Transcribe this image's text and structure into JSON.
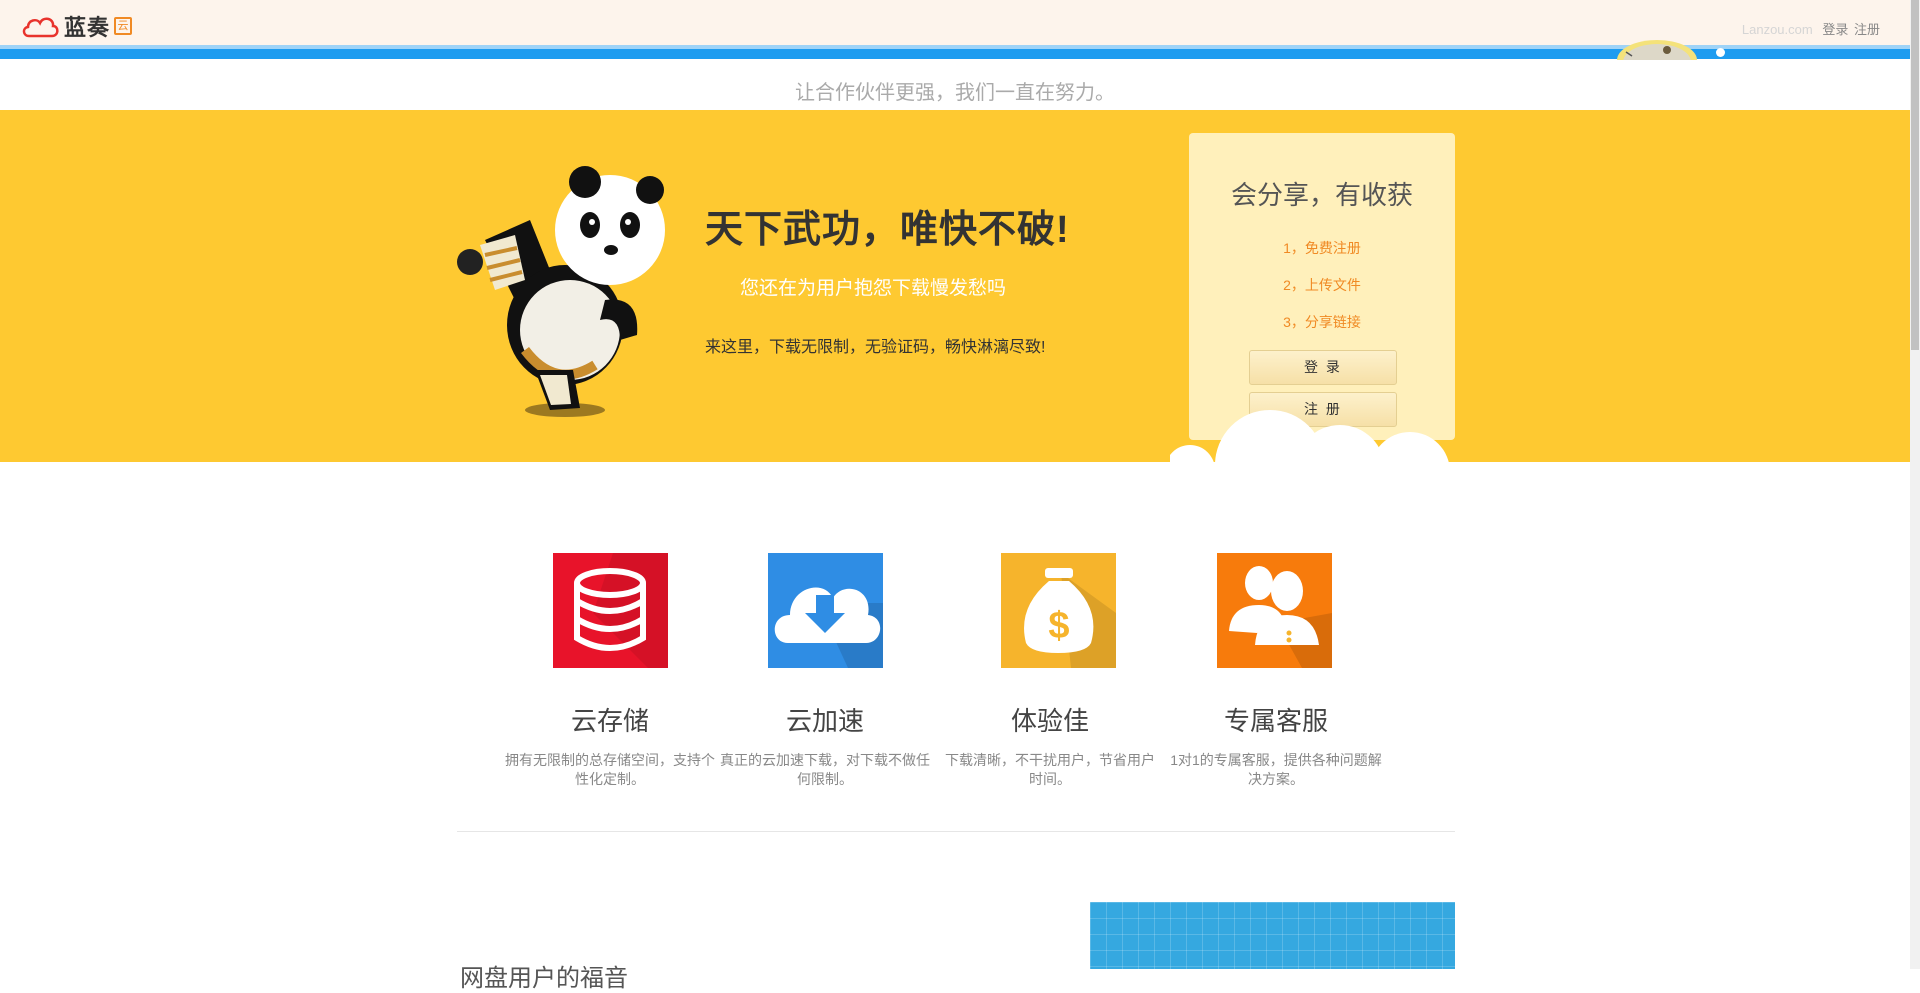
{
  "header": {
    "logo_text": "蓝奏",
    "logo_badge": "云",
    "domain": "Lanzou.com",
    "login": "登录",
    "register": "注册"
  },
  "tagline": "让合作伙伴更强，我们一直在努力。",
  "hero": {
    "title": "天下武功，唯快不破!",
    "subtitle": "您还在为用户抱怨下载慢发愁吗",
    "desc": "来这里，下载无限制，无验证码，畅快淋漓尽致!"
  },
  "card": {
    "title": "会分享，有收获",
    "steps": [
      "1，免费注册",
      "2，上传文件",
      "3，分享链接"
    ],
    "login_button": "登 录",
    "register_button": "注 册"
  },
  "features": [
    {
      "title": "云存储",
      "desc": "拥有无限制的总存储空间，支持个性化定制。",
      "icon": "database-icon",
      "color": "#e8132a"
    },
    {
      "title": "云加速",
      "desc": "真正的云加速下载，对下载不做任何限制。",
      "icon": "cloud-download-icon",
      "color": "#2f8de4"
    },
    {
      "title": "体验佳",
      "desc": "下载清晰，不干扰用户，节省用户时间。",
      "icon": "money-bag-icon",
      "color": "#f6b42c"
    },
    {
      "title": "专属客服",
      "desc": "1对1的专属客服，提供各种问题解决方案。",
      "icon": "support-users-icon",
      "color": "#f77b0c"
    }
  ],
  "bottom_heading": "网盘用户的福音",
  "colors": {
    "hero_bg": "#fec931",
    "accent_orange": "#f08a24",
    "blue_bar": "#1e9cf0"
  }
}
